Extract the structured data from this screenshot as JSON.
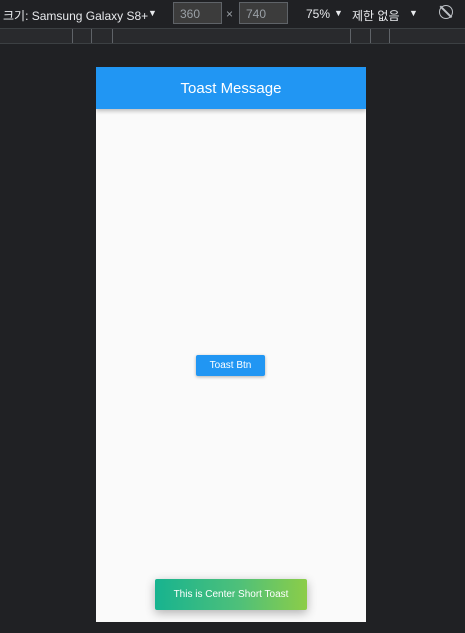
{
  "devtools": {
    "device_label": "크기: Samsung Galaxy S8+",
    "width_value": "360",
    "height_value": "740",
    "times_symbol": "×",
    "zoom": "75%",
    "throttling": "제한 없음"
  },
  "app": {
    "title": "Toast Message",
    "button_label": "Toast Btn",
    "toast_text": "This is Center Short Toast"
  },
  "colors": {
    "appbar": "#2196f3",
    "button": "#2196f3",
    "toast_gradient_start": "#17b38f",
    "toast_gradient_end": "#8ccd48"
  }
}
